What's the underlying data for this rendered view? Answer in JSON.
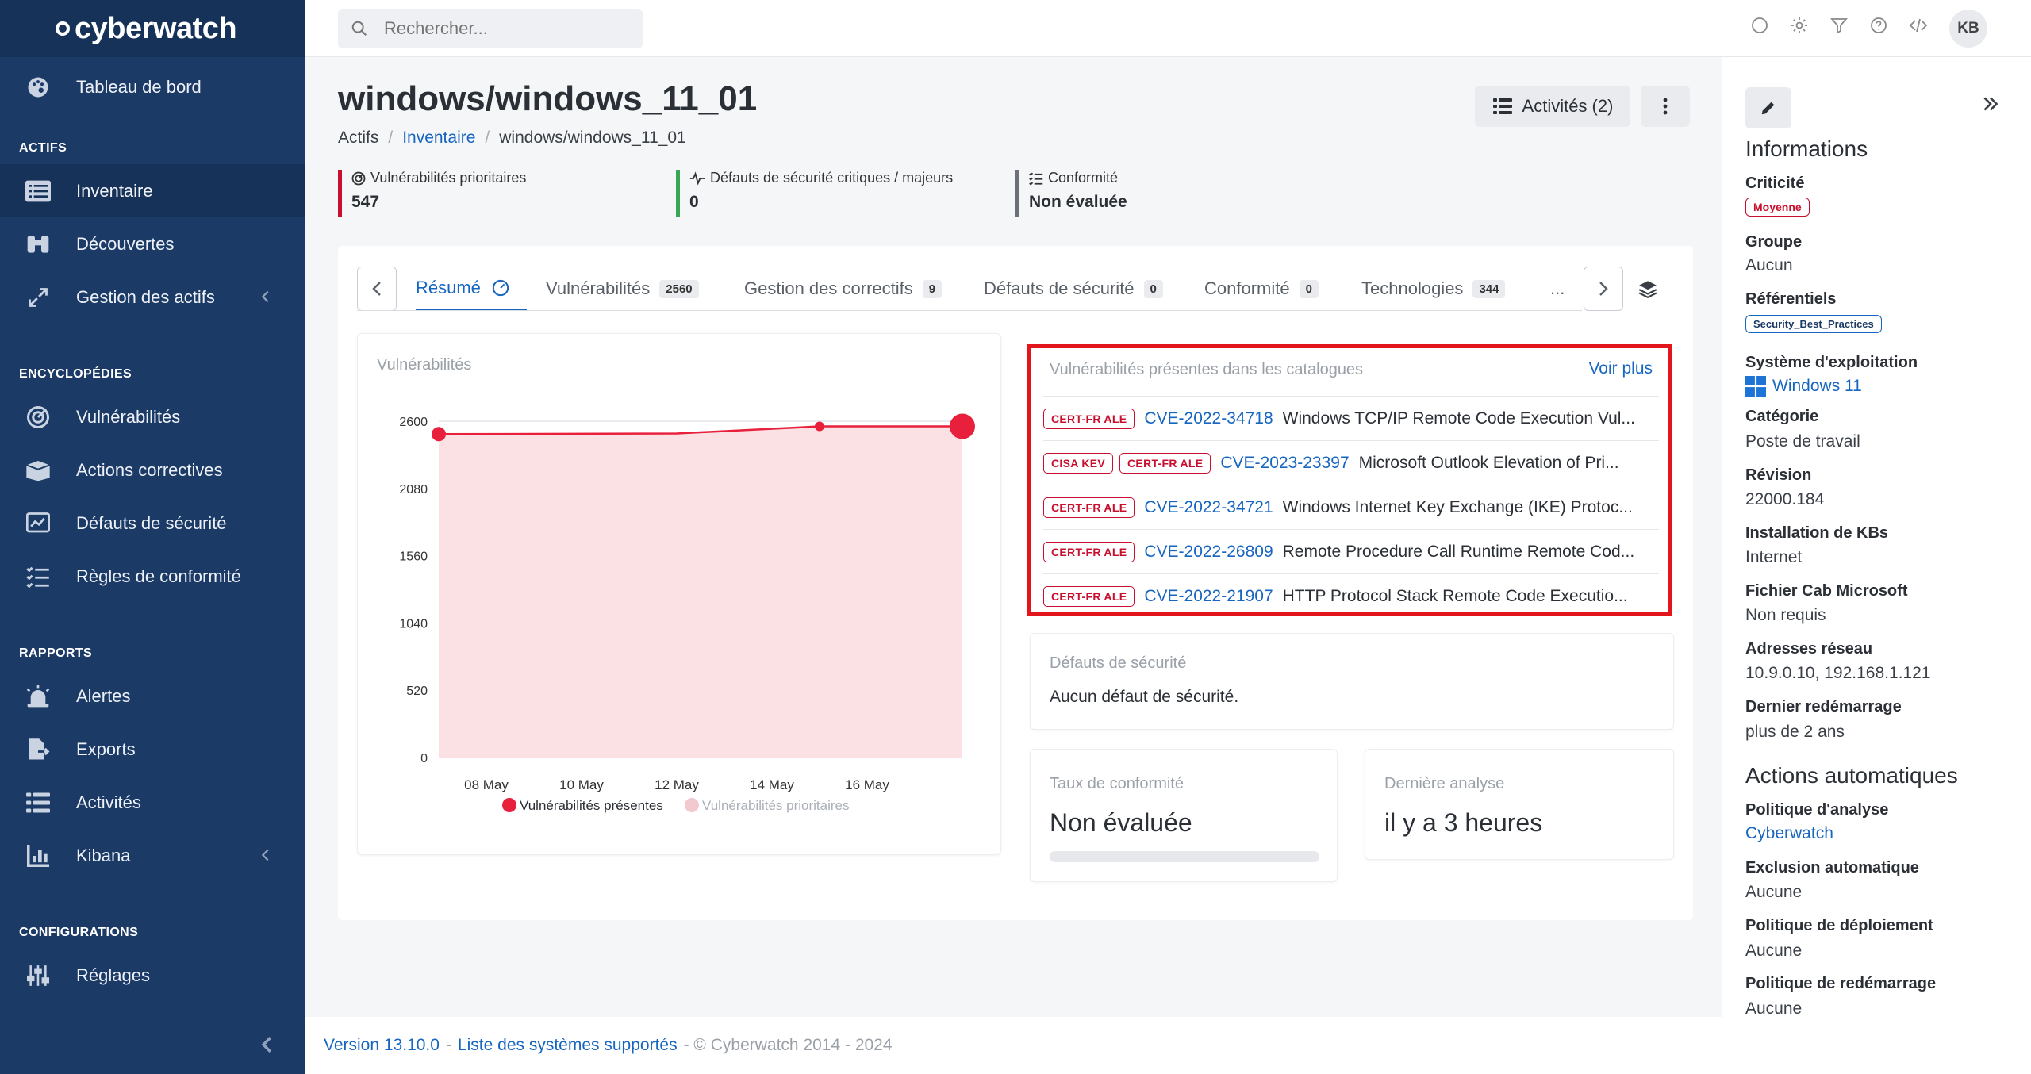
{
  "brand": {
    "name": "cyberwatch"
  },
  "sidebar": {
    "sections": {
      "actifs": "ACTIFS",
      "encyclopedies": "ENCYCLOPÉDIES",
      "rapports": "RAPPORTS",
      "configurations": "CONFIGURATIONS"
    },
    "items": {
      "dashboard": "Tableau de bord",
      "inventory": "Inventaire",
      "discoveries": "Découvertes",
      "asset_mgmt": "Gestion des actifs",
      "vulnerabilities": "Vulnérabilités",
      "corrective": "Actions correctives",
      "security_defects": "Défauts de sécurité",
      "compliance_rules": "Règles de conformité",
      "alerts": "Alertes",
      "exports": "Exports",
      "activities": "Activités",
      "kibana": "Kibana",
      "settings": "Réglages"
    }
  },
  "search": {
    "placeholder": "Rechercher..."
  },
  "user": {
    "initials": "KB"
  },
  "page": {
    "title": "windows/windows_11_01",
    "breadcrumb": {
      "root": "Actifs",
      "parent": "Inventaire",
      "current": "windows/windows_11_01"
    },
    "activities_button": "Activités (2)"
  },
  "kpis": {
    "priority": {
      "label": "Vulnérabilités prioritaires",
      "value": "547"
    },
    "defects": {
      "label": "Défauts de sécurité critiques / majeurs",
      "value": "0"
    },
    "compliance": {
      "label": "Conformité",
      "value": "Non évaluée"
    }
  },
  "tabs": {
    "summary": {
      "label": "Résumé"
    },
    "vulns": {
      "label": "Vulnérabilités",
      "count": "2560"
    },
    "patches": {
      "label": "Gestion des correctifs",
      "count": "9"
    },
    "defects": {
      "label": "Défauts de sécurité",
      "count": "0"
    },
    "compliance": {
      "label": "Conformité",
      "count": "0"
    },
    "tech": {
      "label": "Technologies",
      "count": "344"
    },
    "overflow": "..."
  },
  "chart_data": {
    "type": "area",
    "title": "Vulnérabilités",
    "x": [
      "07 May",
      "12 May",
      "15 May",
      "18 May"
    ],
    "x_ticks": [
      "08 May",
      "10 May",
      "12 May",
      "14 May",
      "16 May"
    ],
    "y_ticks": [
      "2600",
      "2080",
      "1560",
      "1040",
      "520",
      "0"
    ],
    "ylim": [
      0,
      2600
    ],
    "series": [
      {
        "name": "Vulnérabilités présentes",
        "color": "#e8203c",
        "values": [
          2500,
          2505,
          2560,
          2560
        ]
      },
      {
        "name": "Vulnérabilités prioritaires",
        "color": "#f2c9cf",
        "values": []
      }
    ],
    "legend": "bottom"
  },
  "catalog": {
    "header": "Vulnérabilités présentes dans les catalogues",
    "more": "Voir plus",
    "rows": [
      {
        "tags": [
          "CERT-FR ALE"
        ],
        "cve": "CVE-2022-34718",
        "desc": "Windows TCP/IP Remote Code Execution Vul..."
      },
      {
        "tags": [
          "CISA KEV",
          "CERT-FR ALE"
        ],
        "cve": "CVE-2023-23397",
        "desc": "Microsoft Outlook Elevation of Pri..."
      },
      {
        "tags": [
          "CERT-FR ALE"
        ],
        "cve": "CVE-2022-34721",
        "desc": "Windows Internet Key Exchange (IKE) Protoc..."
      },
      {
        "tags": [
          "CERT-FR ALE"
        ],
        "cve": "CVE-2022-26809",
        "desc": "Remote Procedure Call Runtime Remote Cod..."
      },
      {
        "tags": [
          "CERT-FR ALE"
        ],
        "cve": "CVE-2022-21907",
        "desc": "HTTP Protocol Stack Remote Code Executio..."
      }
    ]
  },
  "defects_card": {
    "header": "Défauts de sécurité",
    "text": "Aucun défaut de sécurité."
  },
  "compliance_card": {
    "header": "Taux de conformité",
    "value": "Non évaluée",
    "progress": 0
  },
  "scan_card": {
    "header": "Dernière analyse",
    "value": "il y a 3 heures"
  },
  "info": {
    "title": "Informations",
    "criticality": {
      "label": "Criticité",
      "value": "Moyenne"
    },
    "group": {
      "label": "Groupe",
      "value": "Aucun"
    },
    "standards": {
      "label": "Référentiels",
      "value": "Security_Best_Practices"
    },
    "os": {
      "label": "Système d'exploitation",
      "value": "Windows 11"
    },
    "category": {
      "label": "Catégorie",
      "value": "Poste de travail"
    },
    "revision": {
      "label": "Révision",
      "value": "22000.184"
    },
    "kb": {
      "label": "Installation de KBs",
      "value": "Internet"
    },
    "cab": {
      "label": "Fichier Cab Microsoft",
      "value": "Non requis"
    },
    "net": {
      "label": "Adresses réseau",
      "value": "10.9.0.10, 192.168.1.121"
    },
    "reboot": {
      "label": "Dernier redémarrage",
      "value": "plus de 2 ans"
    }
  },
  "auto": {
    "title": "Actions automatiques",
    "analysis": {
      "label": "Politique d'analyse",
      "value": "Cyberwatch"
    },
    "exclusion": {
      "label": "Exclusion automatique",
      "value": "Aucune"
    },
    "deploy": {
      "label": "Politique de déploiement",
      "value": "Aucune"
    },
    "restart": {
      "label": "Politique de redémarrage",
      "value": "Aucune"
    }
  },
  "footer": {
    "version": "Version 13.10.0",
    "systems": "Liste des systèmes supportés",
    "copyright": "- © Cyberwatch 2014 - 2024"
  },
  "colors": {
    "sidebar": "#1b3a66",
    "accent": "#1665c1",
    "danger": "#e2141c",
    "kpi_red": "#c8102e",
    "kpi_green": "#3aa655",
    "kpi_gray": "#6b7079"
  }
}
